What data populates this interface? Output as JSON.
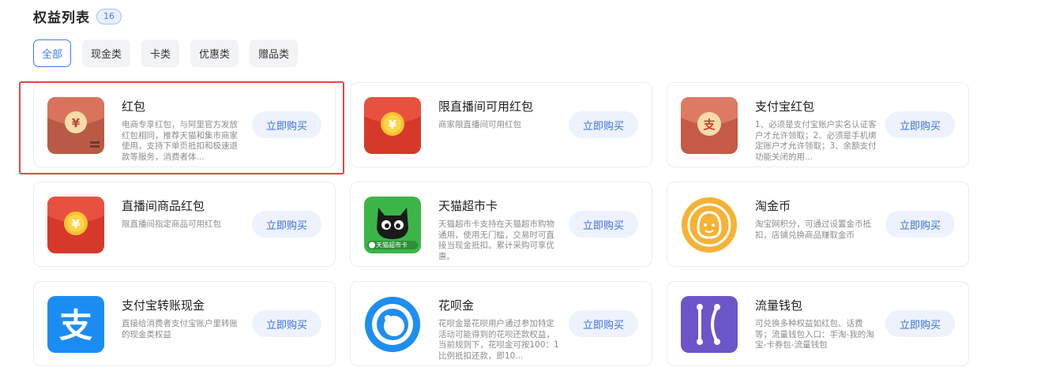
{
  "header": {
    "title": "权益列表",
    "count": "16"
  },
  "filters": [
    "全部",
    "现金类",
    "卡类",
    "优惠类",
    "赠品类"
  ],
  "buy_label": "立即购买",
  "cards": [
    {
      "name": "红包",
      "desc": "电商专享红包，与阿里官方发放红包相同，推荐天猫和集市商家使用，支持下单页抵扣和极速退款等服务，消费者体...",
      "icon": "red-envelope-yuan-icon"
    },
    {
      "name": "限直播间可用红包",
      "desc": "商家限直播间可用红包",
      "icon": "red-envelope-live-icon"
    },
    {
      "name": "支付宝红包",
      "desc": "1、必须是支付宝账户实名认证客户才允许领取；2、必须是手机绑定账户才允许领取；3、余额支付功能关闭的用...",
      "icon": "alipay-red-envelope-icon"
    },
    {
      "name": "直播间商品红包",
      "desc": "限直播间指定商品可用红包",
      "icon": "red-envelope-product-icon"
    },
    {
      "name": "天猫超市卡",
      "desc": "天猫超市卡支持在天猫超市购物通用，使用无门槛，交易时可直接当现金抵扣。累计采购可享优惠。",
      "icon": "tmall-supermarket-card-icon",
      "icon_text": "天猫超市卡"
    },
    {
      "name": "淘金币",
      "desc": "淘宝网积分，可通过设置金币抵扣，店铺兑换商品赚取金币",
      "icon": "taojinbi-coin-icon"
    },
    {
      "name": "支付宝转账现金",
      "desc": "直接给消费者支付宝账户里转账的现金类权益",
      "icon": "alipay-icon"
    },
    {
      "name": "花呗金",
      "desc": "花呗金是花呗用户通过参加特定活动可能得到的花呗还款权益，当前规则下，花呗金可按100：1比例抵扣还款，即10...",
      "icon": "huabei-icon"
    },
    {
      "name": "流量钱包",
      "desc": "可兑换多种权益如红包、话费等；流量钱包入口：手淘-我的淘宝-卡券包-流量钱包",
      "icon": "data-wallet-icon"
    }
  ],
  "colors": {
    "accent": "#3e7bf2",
    "highlight": "#e24848"
  }
}
